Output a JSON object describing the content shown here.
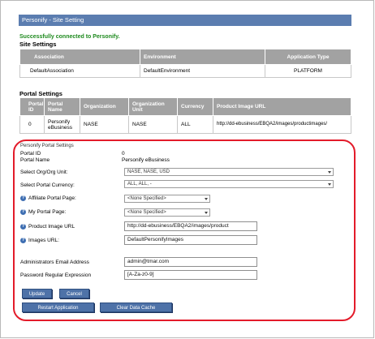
{
  "header": {
    "title": "Personify - Site Setting"
  },
  "status": {
    "message": "Successfully connected to Personify."
  },
  "site_settings": {
    "heading": "Site Settings",
    "columns": [
      "Association",
      "Environment",
      "Application Type"
    ],
    "rows": [
      [
        "DefaultAssociation",
        "DefaultEnvironment",
        "PLATFORM"
      ]
    ]
  },
  "portal_settings": {
    "heading": "Portal Settings",
    "columns": [
      "Portal ID",
      "Portal Name",
      "Organization",
      "Organization Unit",
      "Currency",
      "Product Image URL"
    ],
    "rows": [
      [
        "0",
        "Personify eBusiness",
        "NASE",
        "NASE",
        "ALL",
        "http://dd-ebusiness/EBQA2/images/productimages/"
      ]
    ]
  },
  "form": {
    "legend": "Personify Portal Settings",
    "portal_id_label": "Portal ID",
    "portal_id_value": "0",
    "portal_name_label": "Portal Name",
    "portal_name_value": "Personify eBusiness",
    "org_label": "Select Org/Org Unit:",
    "org_value": "NASE, NASE, USD",
    "currency_label": "Select Portal Currency:",
    "currency_value": "ALL, ALL, -",
    "affiliate_label": "Affiliate Portal Page:",
    "affiliate_value": "<None Specified>",
    "myportal_label": "My Portal Page:",
    "myportal_value": "<None Specified>",
    "product_url_label": "Product Image URL",
    "product_url_value": "http://dd-ebusiness/EBQA2/images/product",
    "images_url_label": "Images URL:",
    "images_url_value": "DefaultPersonifyImages",
    "admin_email_label": "Administrators Email Address",
    "admin_email_value": "admin@tmar.com",
    "password_regex_label": "Password Regular Expression",
    "password_regex_value": "[A-Za-z0-9]"
  },
  "buttons": {
    "update": "Update",
    "cancel": "Cancel",
    "restart": "Restart Application",
    "clear_cache": "Clear Data Cache"
  },
  "colors": {
    "header_bg": "#5b7db0",
    "highlight_border": "#e31b2a",
    "success_text": "#1e8a1e",
    "table_header": "#a2a2a2"
  }
}
